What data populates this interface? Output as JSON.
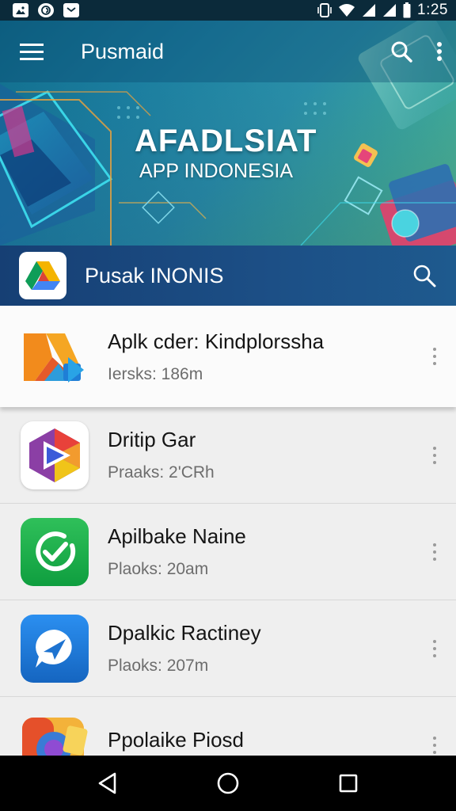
{
  "status_bar": {
    "time": "1:25",
    "left_icons": [
      "gallery-icon",
      "messenger-icon",
      "notification-icon"
    ],
    "right_icons": [
      "vibrate-icon",
      "wifi-icon",
      "signal-icon",
      "signal-icon",
      "battery-icon"
    ]
  },
  "app_bar": {
    "title": "Pusmaid",
    "icons": [
      "menu-icon",
      "search-icon",
      "more-vert-icon"
    ]
  },
  "banner": {
    "title": "AFADLSIAT",
    "subtitle": "APP INDONESIA"
  },
  "section": {
    "title": "Pusak INONIS",
    "icons": [
      "logo-icon",
      "search-icon"
    ]
  },
  "apps": [
    {
      "name": "Aplk cder: Kindplorssha",
      "meta": "Iersks: 186m",
      "icon": "arrow-logo-icon"
    },
    {
      "name": "Dritip Gar",
      "meta": "Praaks: 2'CRh",
      "icon": "play-logo-icon"
    },
    {
      "name": "Apilbake Naine",
      "meta": "Plaoks: 20am",
      "icon": "check-logo-icon"
    },
    {
      "name": "Dpalkic Ractiney",
      "meta": "Plaoks: 207m",
      "icon": "chat-logo-icon"
    },
    {
      "name": "Ppolaike Piosd",
      "meta": "",
      "icon": "folder-logo-icon"
    }
  ],
  "nav_bar": {
    "icons": [
      "back-icon",
      "home-icon",
      "recents-icon"
    ]
  },
  "colors": {
    "status_bar": "#0b2a3a",
    "section_header": "#1c4f86",
    "list_background": "#efefef",
    "nav_bar": "#000000"
  }
}
